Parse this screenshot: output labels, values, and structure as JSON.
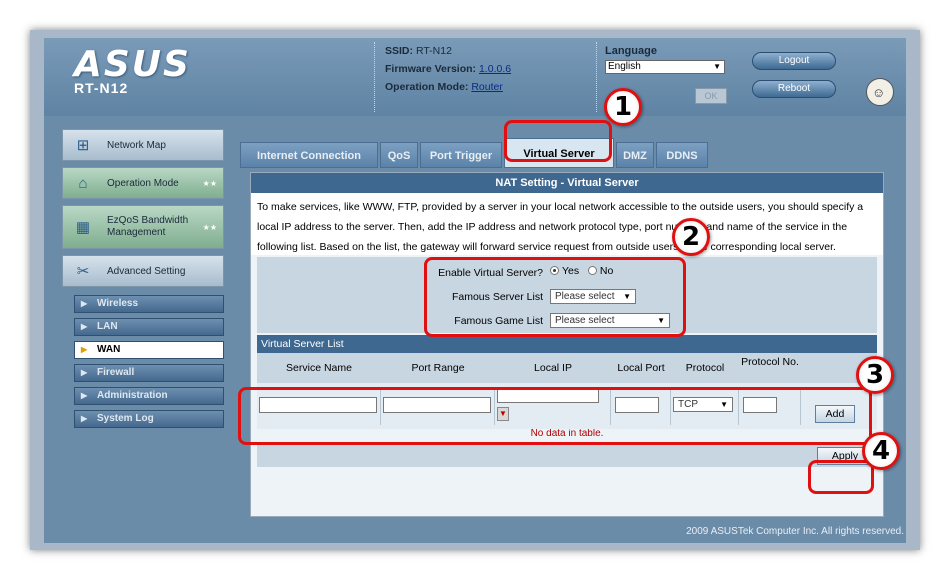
{
  "header": {
    "logo": "ASUS",
    "model": "RT-N12",
    "ssid_label": "SSID:",
    "ssid_value": "RT-N12",
    "firmware_label": "Firmware Version:",
    "firmware_value": "1.0.0.6",
    "mode_label": "Operation Mode:",
    "mode_value": "Router",
    "language_label": "Language",
    "language_value": "English",
    "ok_label": "OK",
    "logout_label": "Logout",
    "reboot_label": "Reboot"
  },
  "sidebar": {
    "main_items": [
      {
        "label": "Network Map",
        "icon": "network-map-icon"
      },
      {
        "label": "Operation Mode",
        "icon": "wifi-router-icon"
      },
      {
        "label": "EzQoS Bandwidth Management",
        "icon": "qos-icon"
      },
      {
        "label": "Advanced Setting",
        "icon": "tools-icon"
      }
    ],
    "sub_items": [
      "Wireless",
      "LAN",
      "WAN",
      "Firewall",
      "Administration",
      "System Log"
    ],
    "active_sub": "WAN"
  },
  "tabs": [
    "Internet Connection",
    "QoS",
    "Port Trigger",
    "Virtual Server",
    "DMZ",
    "DDNS"
  ],
  "active_tab": "Virtual Server",
  "panel": {
    "title": "NAT Setting - Virtual Server",
    "description": "To make services, like WWW, FTP, provided by a server in your local network accessible to the outside users, you should specify a local IP address to the server. Then, add the IP address and network protocol type, port number, and name of the service in the following list. Based on the list, the gateway will forward service request from outside users to the corresponding local server.",
    "enable_label": "Enable Virtual Server?",
    "yes_label": "Yes",
    "no_label": "No",
    "enable_value": "Yes",
    "famous_server_label": "Famous Server List",
    "famous_server_value": "Please select",
    "famous_game_label": "Famous Game List",
    "famous_game_value": "Please select",
    "list_title": "Virtual Server List",
    "columns": [
      "Service Name",
      "Port Range",
      "Local IP",
      "Local Port",
      "Protocol",
      "Protocol No."
    ],
    "protocol_value": "TCP",
    "add_label": "Add",
    "no_data": "No data in table.",
    "apply_label": "Apply"
  },
  "footer": {
    "copyright": "2009 ASUSTek Computer Inc. All rights reserved."
  },
  "annotations": [
    "1",
    "2",
    "3",
    "4"
  ],
  "colors": {
    "highlight": "#e01010",
    "header_blue": "#3f6890",
    "frame_blue": "#6b8ca8"
  }
}
